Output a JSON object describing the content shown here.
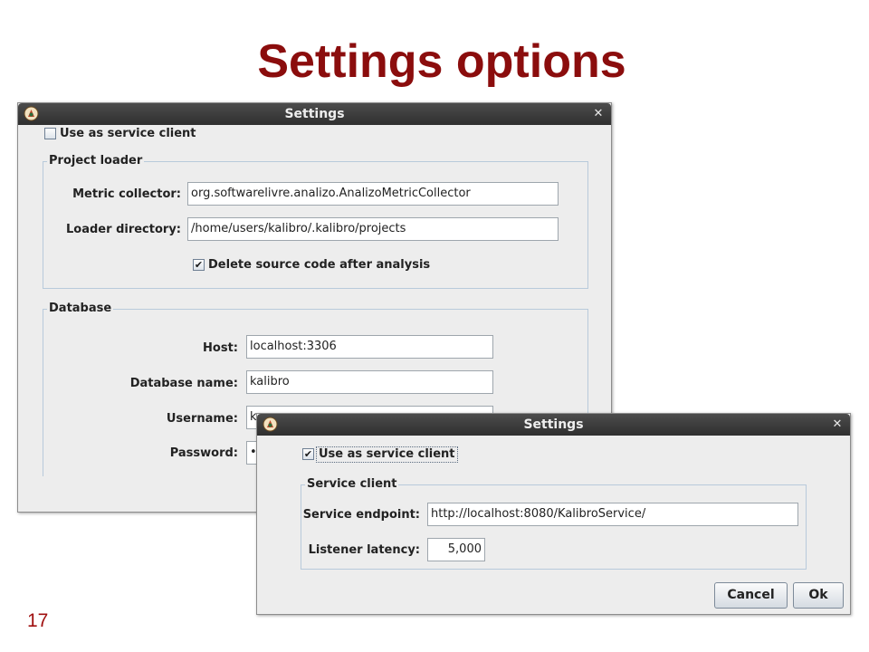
{
  "slide": {
    "title": "Settings options",
    "page_number": "17"
  },
  "window1": {
    "title": "Settings",
    "service_client_label": "Use as service client",
    "service_client_checked": false,
    "project_loader": {
      "legend": "Project loader",
      "metric_collector_label": "Metric collector:",
      "metric_collector_value": "org.softwarelivre.analizo.AnalizoMetricCollector",
      "loader_directory_label": "Loader directory:",
      "loader_directory_value": "/home/users/kalibro/.kalibro/projects",
      "delete_source_label": "Delete source code after analysis",
      "delete_source_checked": true
    },
    "database": {
      "legend": "Database",
      "host_label": "Host:",
      "host_value": "localhost:3306",
      "dbname_label": "Database name:",
      "dbname_value": "kalibro",
      "username_label": "Username:",
      "username_value": "k",
      "password_label": "Password:",
      "password_value": "•"
    }
  },
  "window2": {
    "title": "Settings",
    "service_client_label": "Use as service client",
    "service_client_checked": true,
    "service_client": {
      "legend": "Service client",
      "endpoint_label": "Service endpoint:",
      "endpoint_value": "http://localhost:8080/KalibroService/",
      "latency_label": "Listener latency:",
      "latency_value": "5,000"
    },
    "cancel_label": "Cancel",
    "ok_label": "Ok"
  },
  "icons": {
    "app": "app-icon",
    "close": "close-icon",
    "check": "checkmark-icon"
  },
  "colors": {
    "title": "#8b0d0d",
    "titlebar": "#3a3a3a",
    "window_bg": "#ededed",
    "fieldset_border": "#b8cadb"
  }
}
